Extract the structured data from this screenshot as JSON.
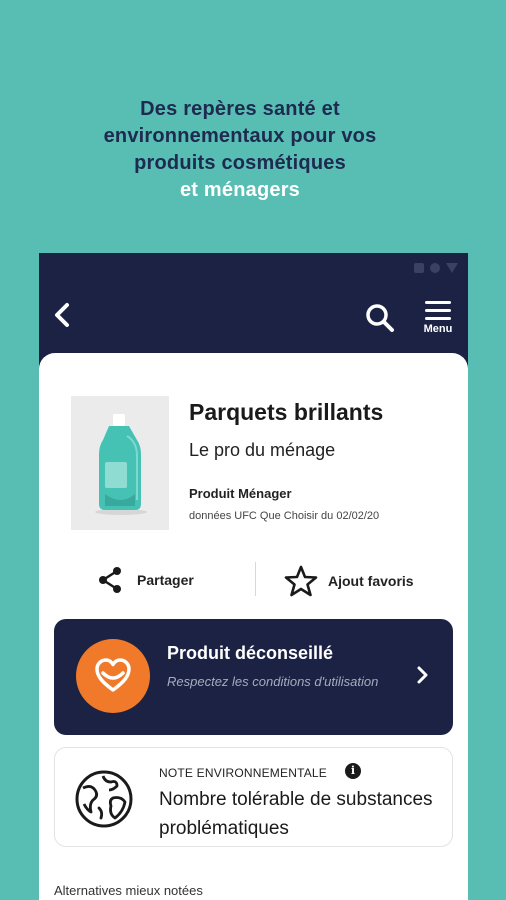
{
  "promo": {
    "line1": "Des repères santé et",
    "line2": "environnementaux pour vos",
    "line3": "produits cosmétiques",
    "line4": "et ménagers"
  },
  "appbar": {
    "menu_label": "Menu",
    "icons": [
      "back-arrow-icon",
      "search-icon",
      "menu-icon"
    ]
  },
  "product": {
    "name": "Parquets brillants",
    "brand": "Le pro du ménage",
    "category": "Produit Ménager",
    "source": "données UFC Que Choisir du 02/02/20",
    "image_icon": "bottle-icon",
    "bottle_color": "#46c2b5"
  },
  "actions": {
    "share_label": "Partager",
    "favorite_label": "Ajout favoris"
  },
  "warning": {
    "title": "Produit déconseillé",
    "subtitle": "Respectez les conditions d'utilisation",
    "color": "#f07a2a",
    "background": "#1b2243"
  },
  "environment": {
    "label": "NOTE ENVIRONNEMENTALE",
    "text": "Nombre tolérable de substances problématiques"
  },
  "alternatives": {
    "label": "Alternatives mieux notées"
  }
}
